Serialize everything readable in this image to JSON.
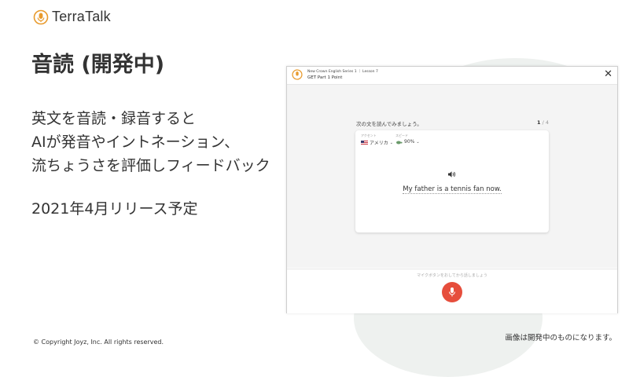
{
  "brand": {
    "name": "TerraTalk"
  },
  "slide": {
    "title": "音読 (開発中)",
    "description": [
      "英文を音読・録音すると",
      "AIが発音やイントネーション、",
      "流ちょうさを評価しフィードバック"
    ],
    "release": "2021年4月リリース予定",
    "copyright": "© Copyright Joyz, Inc. All rights reserved.",
    "note": "画像は開発中のものになります。"
  },
  "app": {
    "header": {
      "series": "New Crown English Series 1  ｜ Lesson 7",
      "part": "GET Part 1  Point",
      "close_icon": "close-icon"
    },
    "instruction": "次の文を読んでみましょう。",
    "counter": {
      "current": "1",
      "separator": " / ",
      "total": "4"
    },
    "accent": {
      "label": "アクセント",
      "value": "アメリカ",
      "icon": "us-flag-icon"
    },
    "speed": {
      "label": "スピード",
      "value": "90%",
      "icon": "turtle-icon"
    },
    "sentence": "My father is a tennis fan now.",
    "mic_hint": "マイクボタンをおしてから話しましょう",
    "mic_icon": "microphone-icon"
  },
  "colors": {
    "brand_orange": "#e89a2c",
    "mic_red": "#e64e3c",
    "text": "#333333",
    "background_blob": "#eef1ef"
  }
}
